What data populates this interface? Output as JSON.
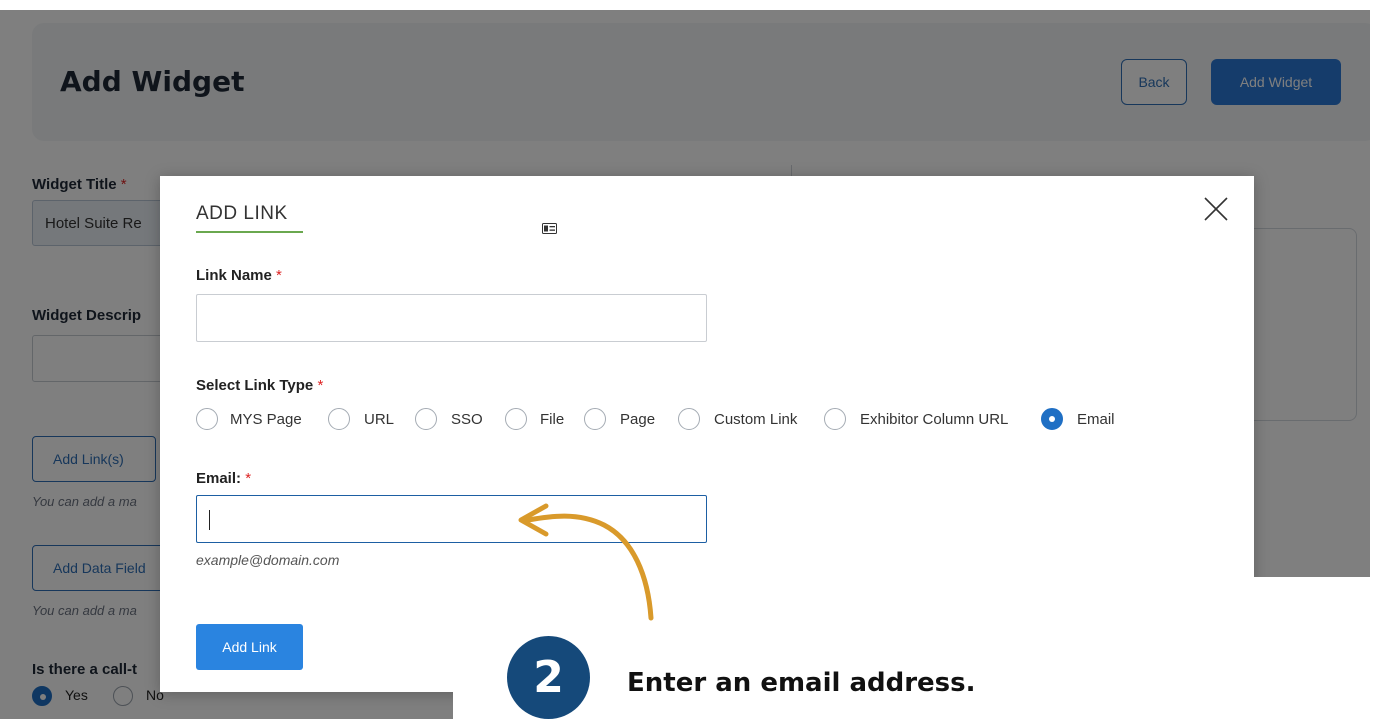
{
  "page": {
    "title": "Add Widget",
    "back_label": "Back",
    "add_widget_label": "Add Widget"
  },
  "form": {
    "widget_title_label": "Widget Title",
    "widget_title_value": "Hotel Suite Re",
    "widget_description_label": "Widget Descrip",
    "add_links_label": "Add Link(s)",
    "add_links_help": "You can add a ma",
    "add_data_field_label": "Add Data Field",
    "add_data_field_help": "You can add a ma",
    "cta_label": "Is there a call-t",
    "cta_options": [
      "Yes",
      "No"
    ],
    "cta_selected": "Yes",
    "required_mark": "*"
  },
  "modal": {
    "title": "ADD LINK",
    "card_icon": "id-card-icon",
    "close_icon": "close-icon",
    "link_name_label": "Link Name",
    "link_name_value": "",
    "link_type_label": "Select Link Type",
    "link_types": [
      "MYS Page",
      "URL",
      "SSO",
      "File",
      "Page",
      "Custom Link",
      "Exhibitor Column URL",
      "Email"
    ],
    "selected_link_type": "Email",
    "email_label": "Email:",
    "email_value": "",
    "email_hint": "example@domain.com",
    "add_link_button": "Add Link",
    "required_mark": "*"
  },
  "callout": {
    "step_number": "2",
    "text": "Enter an email address.",
    "circle_color": "#15497a",
    "arrow_color": "#d99a2b"
  },
  "colors": {
    "primary": "#2a84e0",
    "radio_selected": "#1f6fc4",
    "title_underline": "#6aa84f",
    "required": "#dd2222"
  }
}
